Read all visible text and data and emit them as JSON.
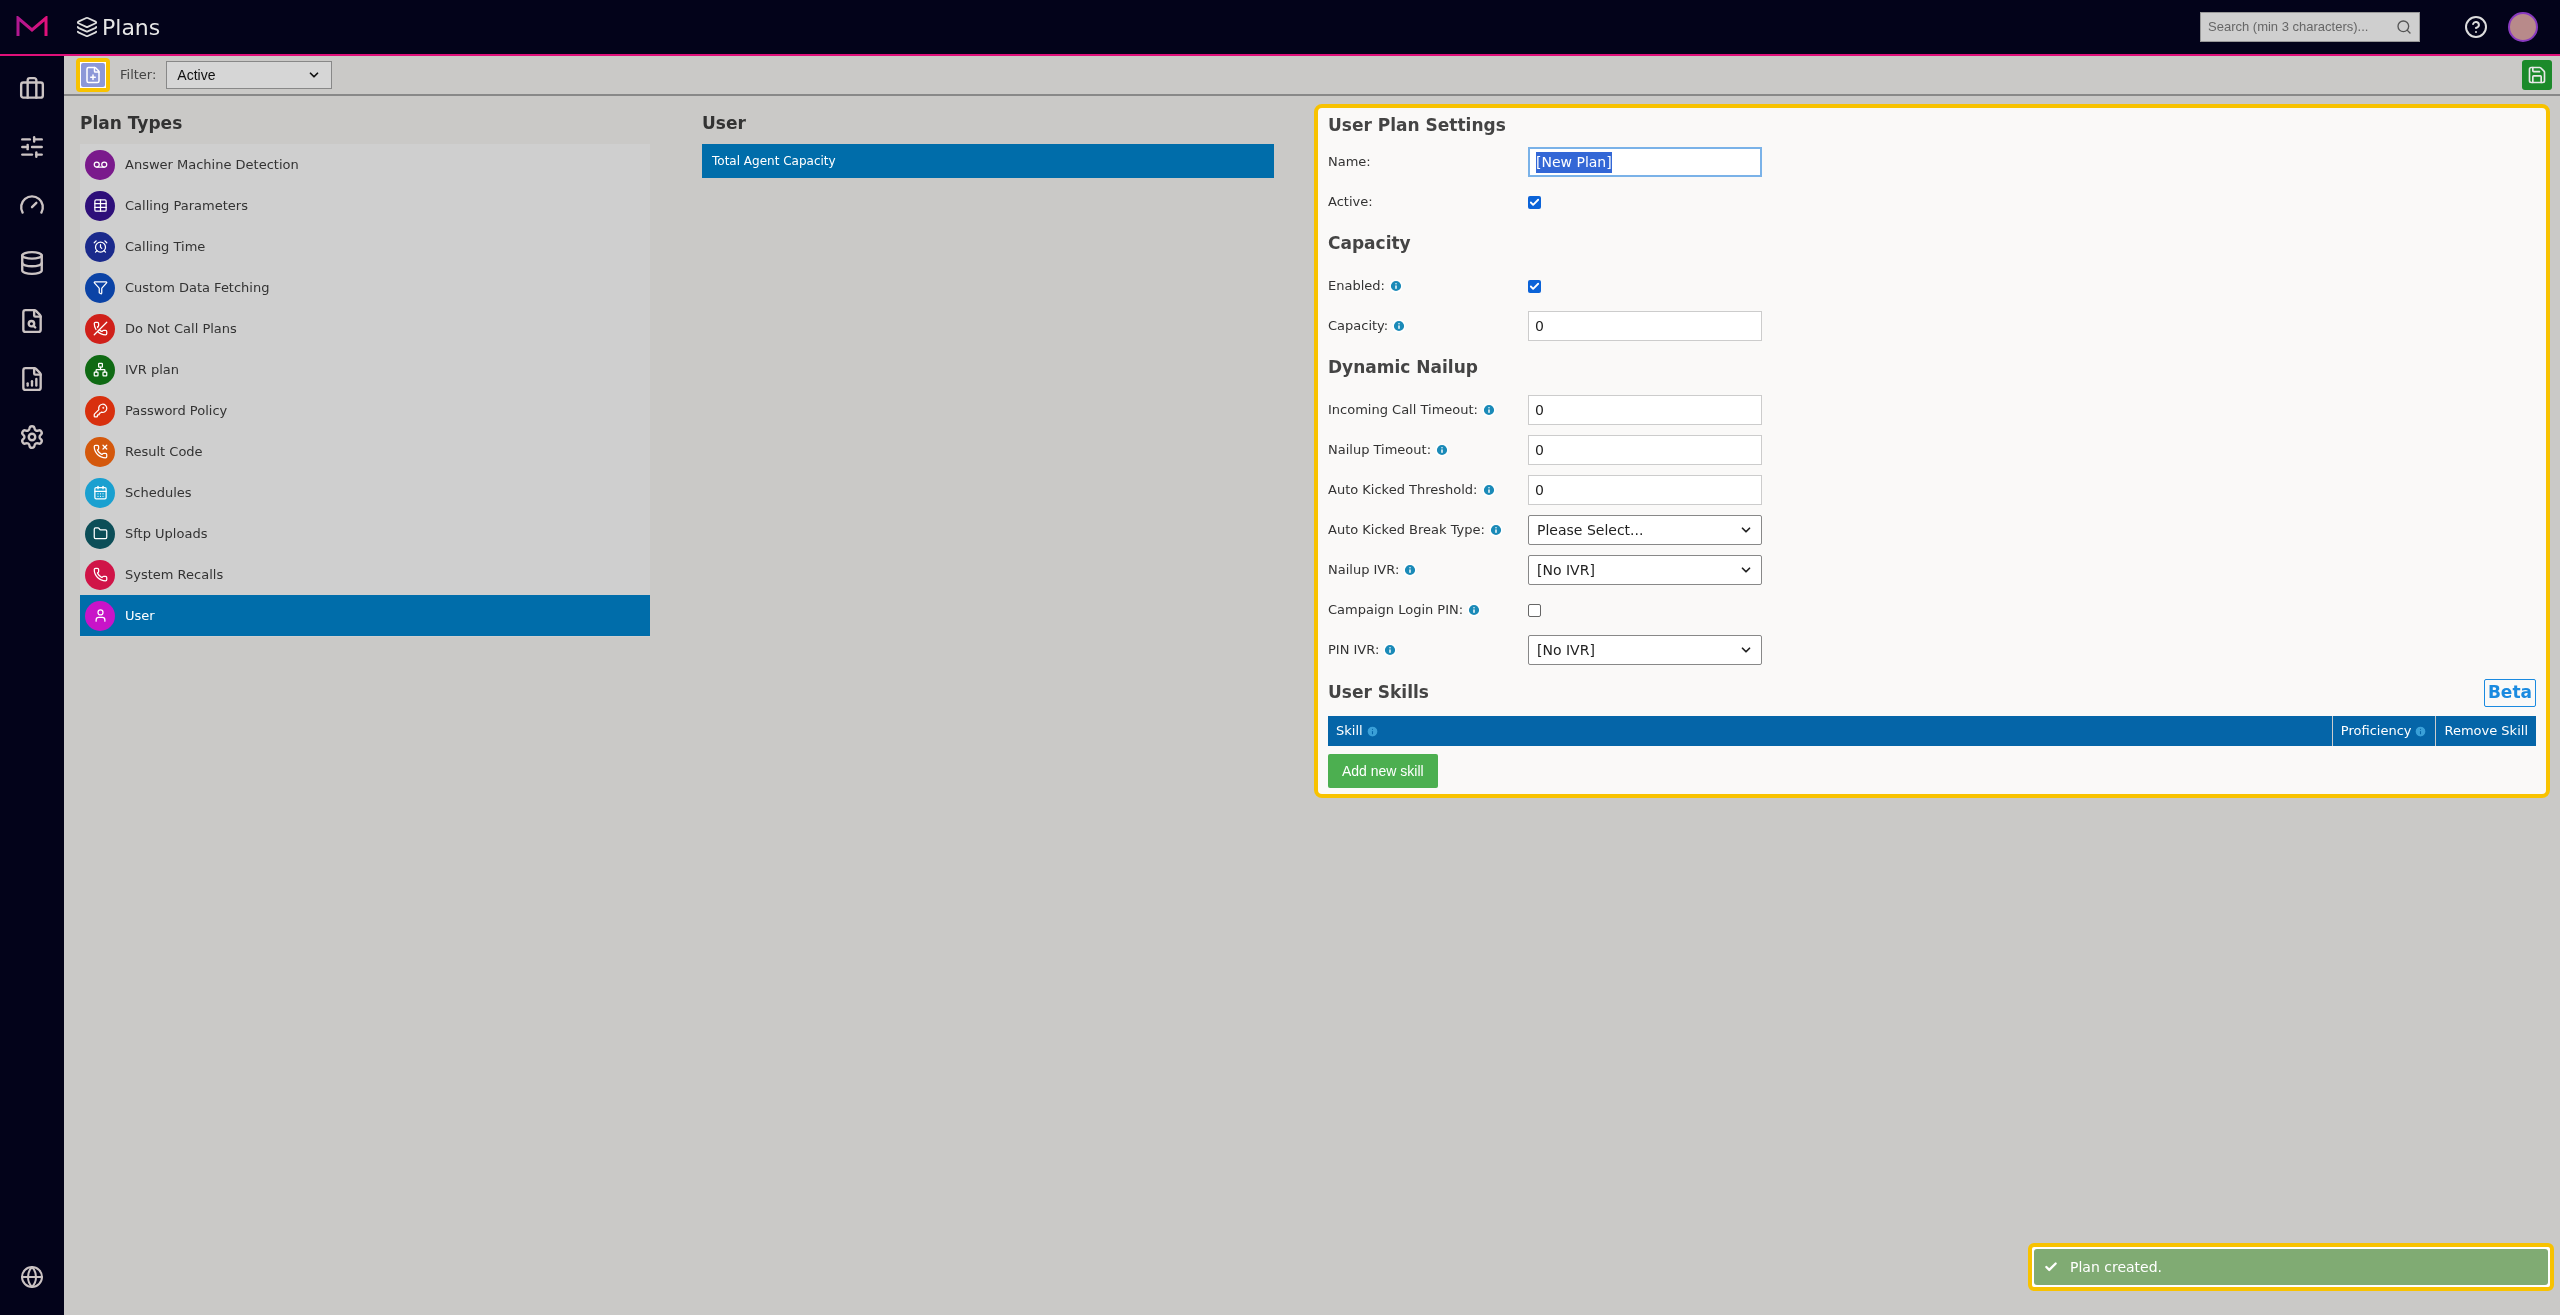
{
  "header": {
    "title": "Plans",
    "search": {
      "placeholder": "Search (min 3 characters)..."
    }
  },
  "toolbar": {
    "filter_label": "Filter:",
    "filter_value": "Active"
  },
  "plan_types": {
    "title": "Plan Types",
    "items": [
      {
        "label": "Answer Machine Detection",
        "color": "#7a1a8c",
        "selected": false
      },
      {
        "label": "Calling Parameters",
        "color": "#2e0f7a",
        "selected": false
      },
      {
        "label": "Calling Time",
        "color": "#1a2a8c",
        "selected": false
      },
      {
        "label": "Custom Data Fetching",
        "color": "#0b43a6",
        "selected": false
      },
      {
        "label": "Do Not Call Plans",
        "color": "#d0201a",
        "selected": false
      },
      {
        "label": "IVR plan",
        "color": "#0f6a14",
        "selected": false
      },
      {
        "label": "Password Policy",
        "color": "#d8300e",
        "selected": false
      },
      {
        "label": "Result Code",
        "color": "#d4580c",
        "selected": false
      },
      {
        "label": "Schedules",
        "color": "#1aa0d0",
        "selected": false
      },
      {
        "label": "Sftp Uploads",
        "color": "#0c4e58",
        "selected": false
      },
      {
        "label": "System Recalls",
        "color": "#d01448",
        "selected": false
      },
      {
        "label": "User",
        "color": "#c814c8",
        "selected": true
      }
    ]
  },
  "user": {
    "title": "User",
    "items": [
      {
        "label": "Total Agent Capacity",
        "selected": true
      }
    ]
  },
  "settings": {
    "title": "User Plan Settings",
    "sections": [
      {
        "fields": [
          {
            "label": "Name:",
            "kind": "text",
            "info": false,
            "value": "[New Plan]",
            "focused": true
          },
          {
            "label": "Active:",
            "kind": "checkbox",
            "info": false,
            "checked": true
          }
        ]
      },
      {
        "title": "Capacity",
        "fields": [
          {
            "label": "Enabled:",
            "kind": "checkbox",
            "info": true,
            "checked": true
          },
          {
            "label": "Capacity:",
            "kind": "text",
            "info": true,
            "value": "0",
            "focused": false
          }
        ]
      },
      {
        "title": "Dynamic Nailup",
        "fields": [
          {
            "label": "Incoming Call Timeout:",
            "kind": "text",
            "info": true,
            "value": "0",
            "focused": false
          },
          {
            "label": "Nailup Timeout:",
            "kind": "text",
            "info": true,
            "value": "0",
            "focused": false
          },
          {
            "label": "Auto Kicked Threshold:",
            "kind": "text",
            "info": true,
            "value": "0",
            "focused": false
          },
          {
            "label": "Auto Kicked Break Type:",
            "kind": "select",
            "info": true,
            "value": "Please Select..."
          },
          {
            "label": "Nailup IVR:",
            "kind": "select",
            "info": true,
            "value": "[No IVR]"
          },
          {
            "label": "Campaign Login PIN:",
            "kind": "checkbox",
            "info": true,
            "checked": false
          },
          {
            "label": "PIN IVR:",
            "kind": "select",
            "info": true,
            "value": "[No IVR]"
          }
        ]
      }
    ],
    "skills": {
      "title": "User Skills",
      "badge": "Beta",
      "columns": [
        {
          "label": "Skill",
          "info": true
        },
        {
          "label": "Proficiency",
          "info": true
        },
        {
          "label": "Remove Skill",
          "info": false
        }
      ],
      "add_button": "Add new skill"
    }
  },
  "toast": {
    "message": "Plan created."
  }
}
